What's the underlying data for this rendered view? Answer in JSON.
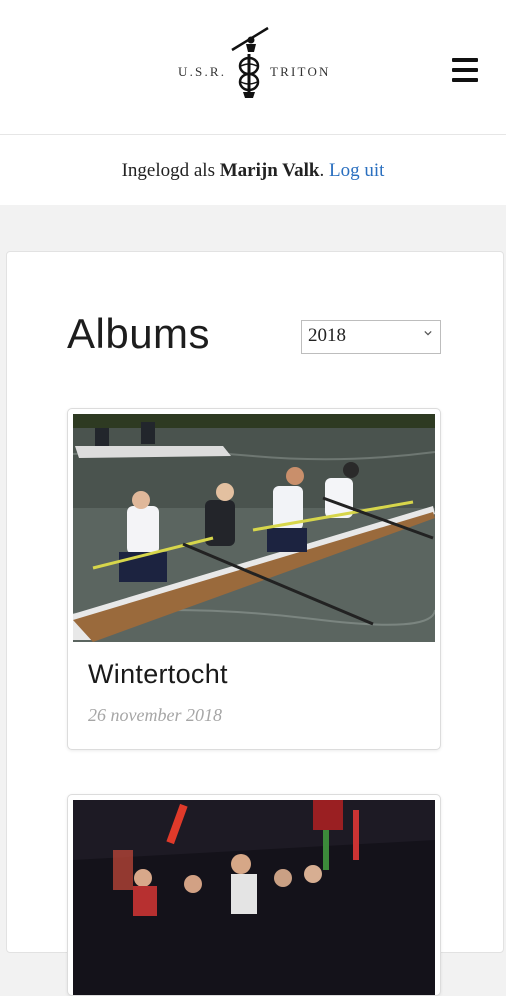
{
  "header": {
    "logo_left": "U.S.R.",
    "logo_right": "TRITON",
    "menu_icon": "hamburger-menu-icon"
  },
  "login": {
    "prefix": "Ingelogd als",
    "user": "Marijn Valk",
    "logout": "Log uit"
  },
  "main": {
    "title": "Albums",
    "year_select": {
      "value": "2018"
    },
    "albums": [
      {
        "title": "Wintertocht",
        "date": "26 november 2018"
      },
      {
        "title": "",
        "date": ""
      }
    ]
  },
  "colors": {
    "link": "#2a6fbf",
    "date": "#a6a6a6"
  }
}
